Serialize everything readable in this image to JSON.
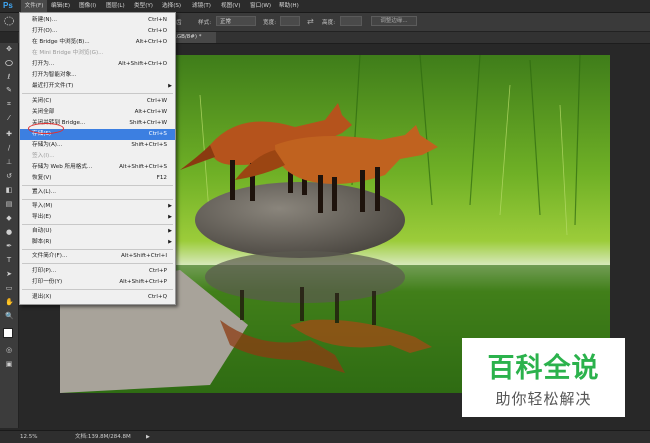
{
  "app": {
    "logo": "Ps"
  },
  "menubar": {
    "items": [
      {
        "label": "文件(F)"
      },
      {
        "label": "编辑(E)"
      },
      {
        "label": "图像(I)"
      },
      {
        "label": "图层(L)"
      },
      {
        "label": "类型(Y)"
      },
      {
        "label": "选择(S)"
      },
      {
        "label": "滤镜(T)"
      },
      {
        "label": "视图(V)"
      },
      {
        "label": "窗口(W)"
      },
      {
        "label": "帮助(H)"
      }
    ]
  },
  "options_bar": {
    "fragment_label": "齿",
    "style_label": "样式:",
    "style_value": "正常",
    "width_label": "宽度:",
    "height_label": "高度:",
    "refine_edge_button": "调整边缘..."
  },
  "document_tab": {
    "label": "RGB/8#) *"
  },
  "file_menu": {
    "items": [
      {
        "label": "新建(N)...",
        "shortcut": "Ctrl+N",
        "disabled": false,
        "submenu": false
      },
      {
        "label": "打开(O)...",
        "shortcut": "Ctrl+O",
        "disabled": false,
        "submenu": false
      },
      {
        "label": "在 Bridge 中浏览(B)...",
        "shortcut": "Alt+Ctrl+O",
        "disabled": false,
        "submenu": false
      },
      {
        "label": "在 Mini Bridge 中浏览(G)...",
        "shortcut": "",
        "disabled": true,
        "submenu": false
      },
      {
        "label": "打开为...",
        "shortcut": "Alt+Shift+Ctrl+O",
        "disabled": false,
        "submenu": false
      },
      {
        "label": "打开为智能对象...",
        "shortcut": "",
        "disabled": false,
        "submenu": false
      },
      {
        "label": "最近打开文件(T)",
        "shortcut": "",
        "disabled": false,
        "submenu": true
      },
      {
        "label": "关闭(C)",
        "shortcut": "Ctrl+W",
        "disabled": false,
        "submenu": false
      },
      {
        "label": "关闭全部",
        "shortcut": "Alt+Ctrl+W",
        "disabled": false,
        "submenu": false
      },
      {
        "label": "关闭并转到 Bridge...",
        "shortcut": "Shift+Ctrl+W",
        "disabled": false,
        "submenu": false
      },
      {
        "label": "存储(S)",
        "shortcut": "Ctrl+S",
        "disabled": false,
        "submenu": false,
        "selected": true
      },
      {
        "label": "存储为(A)...",
        "shortcut": "Shift+Ctrl+S",
        "disabled": false,
        "submenu": false
      },
      {
        "label": "签入(I)...",
        "shortcut": "",
        "disabled": true,
        "submenu": false
      },
      {
        "label": "存储为 Web 所用格式...",
        "shortcut": "Alt+Shift+Ctrl+S",
        "disabled": false,
        "submenu": false
      },
      {
        "label": "恢复(V)",
        "shortcut": "F12",
        "disabled": false,
        "submenu": false
      },
      {
        "label": "置入(L)...",
        "shortcut": "",
        "disabled": false,
        "submenu": false
      },
      {
        "label": "导入(M)",
        "shortcut": "",
        "disabled": false,
        "submenu": true
      },
      {
        "label": "导出(E)",
        "shortcut": "",
        "disabled": false,
        "submenu": true
      },
      {
        "label": "自动(U)",
        "shortcut": "",
        "disabled": false,
        "submenu": true
      },
      {
        "label": "脚本(R)",
        "shortcut": "",
        "disabled": false,
        "submenu": true
      },
      {
        "label": "文件简介(F)...",
        "shortcut": "Alt+Shift+Ctrl+I",
        "disabled": false,
        "submenu": false
      },
      {
        "label": "打印(P)...",
        "shortcut": "Ctrl+P",
        "disabled": false,
        "submenu": false
      },
      {
        "label": "打印一份(Y)",
        "shortcut": "Alt+Shift+Ctrl+P",
        "disabled": false,
        "submenu": false
      },
      {
        "label": "退出(X)",
        "shortcut": "Ctrl+Q",
        "disabled": false,
        "submenu": false
      }
    ]
  },
  "status_bar": {
    "zoom": "12.5%",
    "doc_info": "文档:139.8M/284.8M"
  },
  "watermark": {
    "title": "百科全说",
    "subtitle": "助你轻松解决"
  },
  "colors": {
    "menu_highlight": "#3c7fe1",
    "annotation_circle": "#e03030",
    "watermark_green": "#2bb24c"
  }
}
